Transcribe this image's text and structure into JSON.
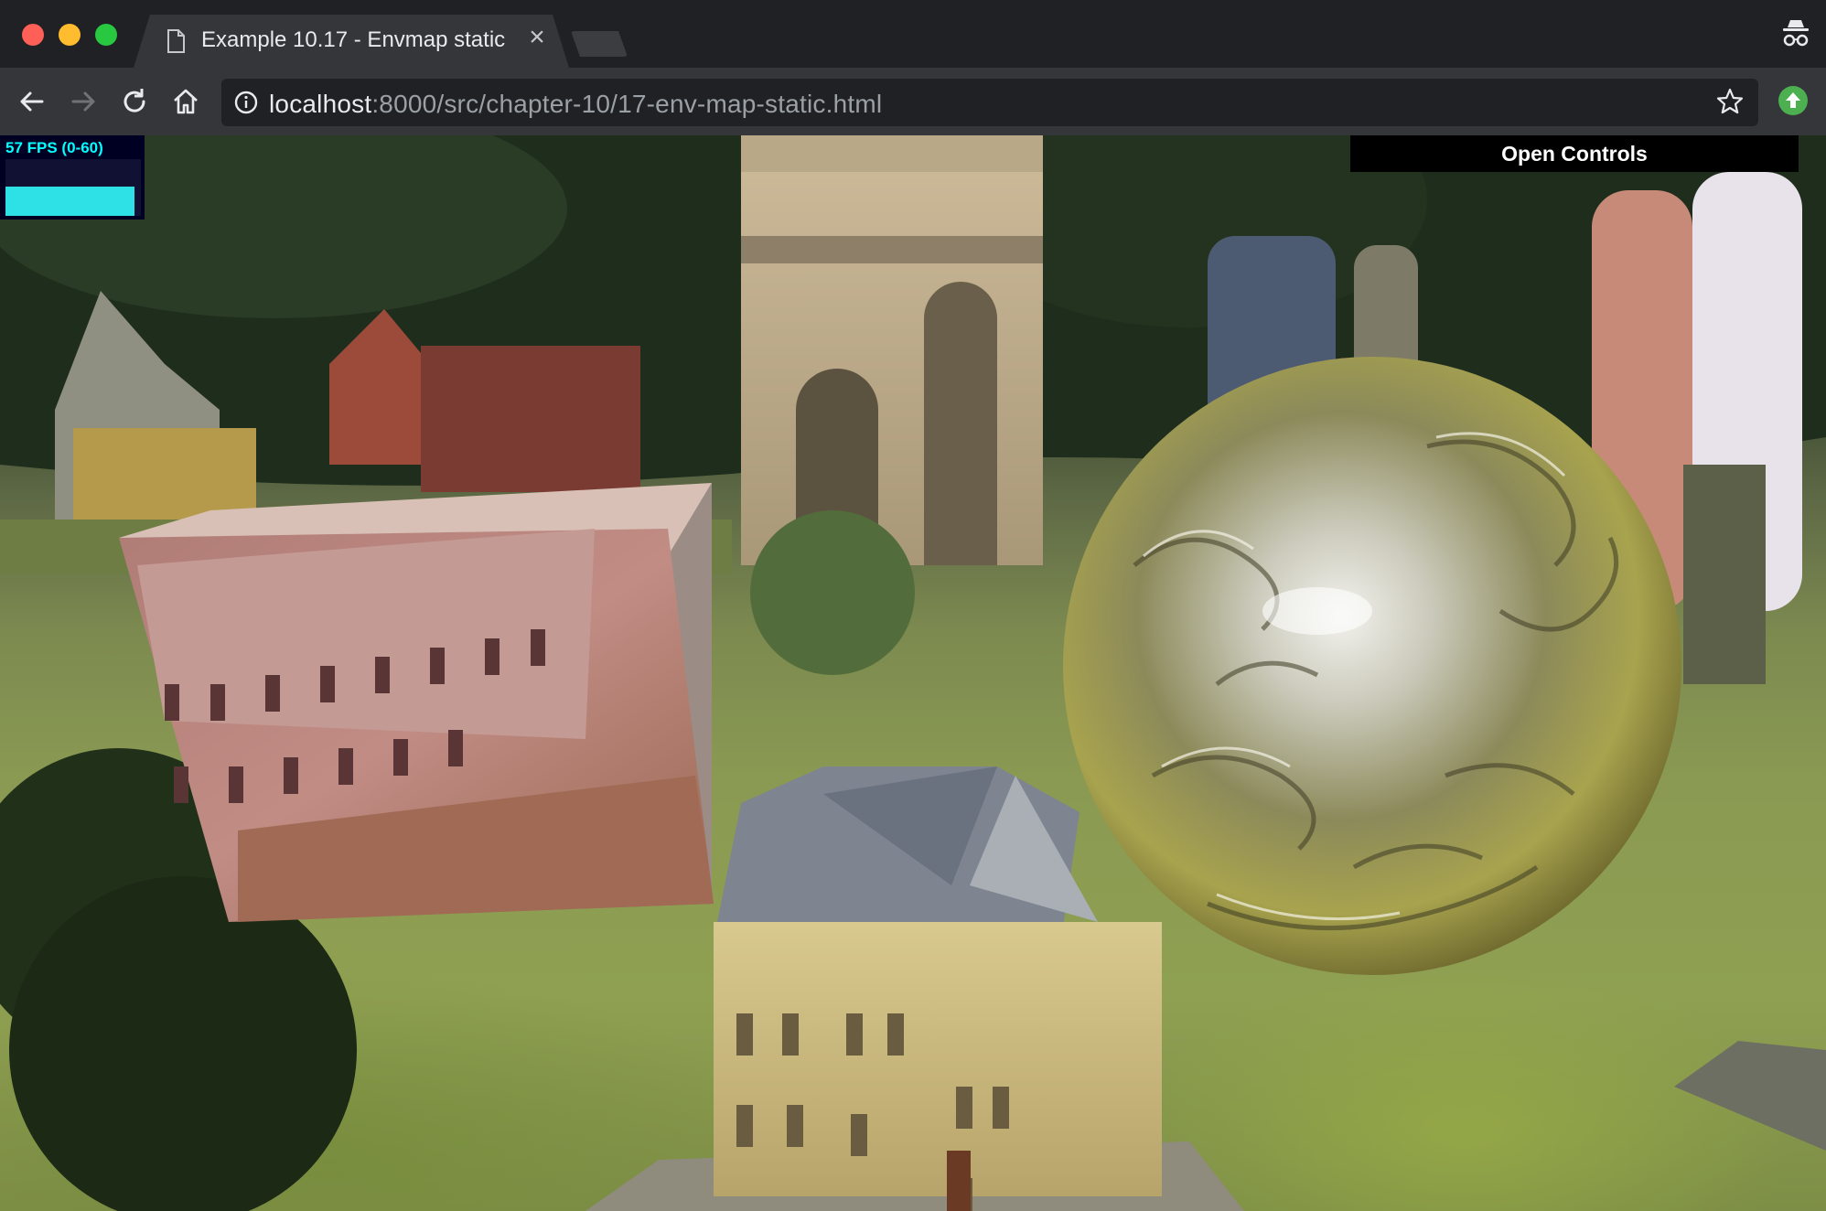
{
  "window": {
    "tab_title": "Example 10.17 - Envmap static",
    "tab_close": "×"
  },
  "toolbar": {
    "url_host": "localhost",
    "url_rest": ":8000/src/chapter-10/17-env-map-static.html"
  },
  "viewport": {
    "fps_label": "57 FPS (0-60)",
    "fps_value": 57,
    "fps_range": [
      0,
      60
    ],
    "controls_label": "Open Controls"
  },
  "colors": {
    "chrome_dark": "#202124",
    "chrome_toolbar": "#35363a",
    "fps_accent": "#00ffff",
    "controls_bg": "#000000"
  },
  "icons": [
    "document-icon",
    "close-icon",
    "incognito-icon",
    "back-arrow-icon",
    "forward-arrow-icon",
    "reload-icon",
    "home-icon",
    "info-icon",
    "star-icon",
    "extension-update-icon"
  ]
}
